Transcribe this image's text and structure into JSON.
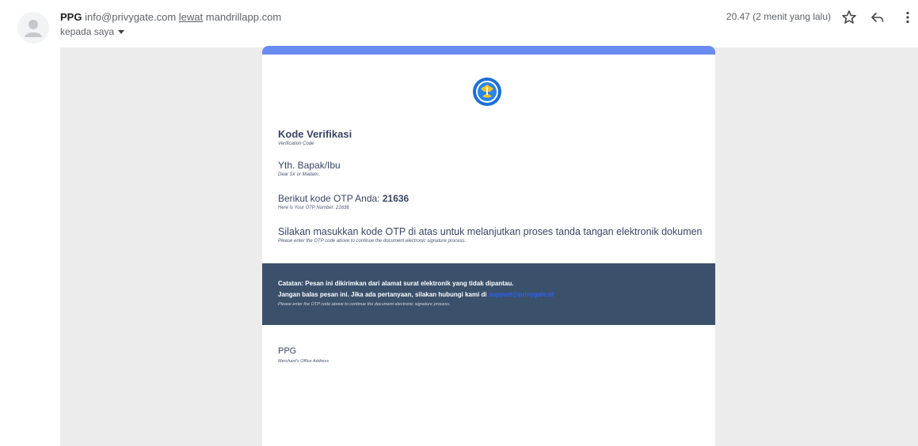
{
  "header": {
    "sender_name": "PPG",
    "sender_email": "info@privygate.com",
    "via_label": "lewat",
    "via_domain": "mandrillapp.com",
    "to_label": "kepada saya",
    "time": "20.47 (2 menit yang lalu)",
    "icons": [
      "avatar-icon",
      "star-icon",
      "reply-icon",
      "more-vert-icon"
    ]
  },
  "email": {
    "title_id": "Kode Verifikasi",
    "title_en": "Verification Code",
    "greeting_id": "Yth. Bapak/Ibu",
    "greeting_en": "Dear Sir or Madam,",
    "otp_prefix_id": "Berikut kode OTP Anda: ",
    "otp_code": "21636",
    "otp_en": "Here is Your OTP Number: 21636",
    "instruction_id": "Silakan masukkan kode OTP di atas untuk melanjutkan proses tanda tangan elektronik dokumen",
    "instruction_en": "Please enter the OTP code above to continue the document electronic signature process.",
    "notice_line1": "Catatan: Pesan ini dikirimkan dari alamat surat elektronik yang tidak dipantau.",
    "notice_line2": "Jangan balas pesan ini. Jika ada pertanyaan, silakan hubungi kami di",
    "notice_link": "support@privygate.id",
    "notice_en": "Please enter the OTP code above to continue the document electronic signature process.",
    "footer_name": "PPG",
    "footer_address": "Merchant's Office Address"
  },
  "colors": {
    "accent_bar": "#6a8bf0",
    "notice_bg": "#3b506b",
    "text_dark": "#3a4566",
    "page_bg": "#ececec"
  }
}
